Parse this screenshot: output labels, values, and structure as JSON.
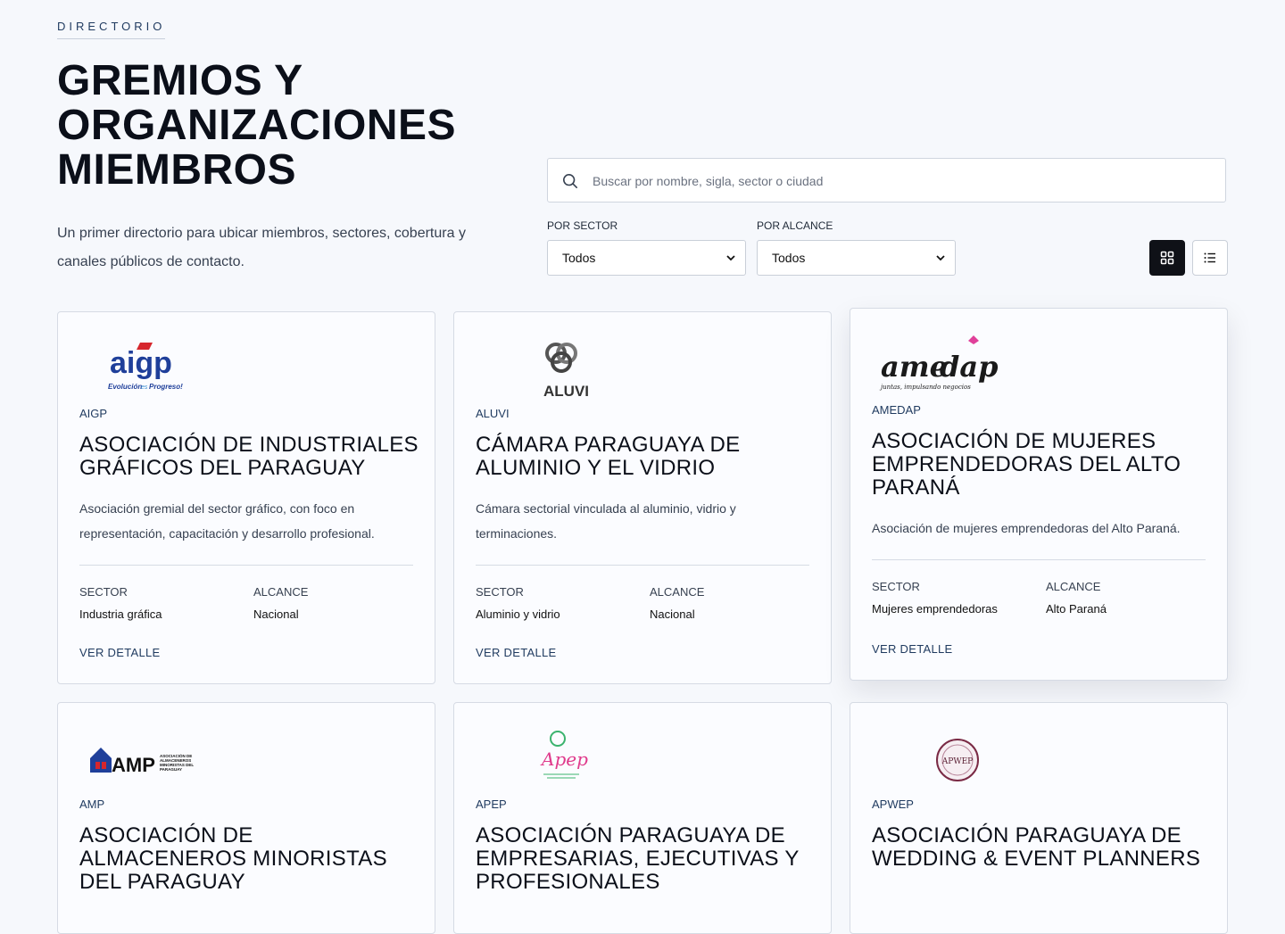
{
  "header": {
    "eyebrow": "DIRECTORIO",
    "title": "GREMIOS Y ORGANIZACIONES MIEMBROS",
    "lede": "Un primer directorio para ubicar miembros, sectores, cobertura y canales públicos de contacto."
  },
  "search": {
    "placeholder": "Buscar por nombre, sigla, sector o ciudad",
    "value": "",
    "icon": "search-icon"
  },
  "filters": {
    "sector_label": "POR SECTOR",
    "sector_value": "Todos",
    "alcance_label": "POR ALCANCE",
    "alcance_value": "Todos"
  },
  "view_toggle": {
    "active": "grid",
    "icons": [
      "grid-icon",
      "list-icon"
    ]
  },
  "labels": {
    "sector": "SECTOR",
    "alcance": "ALCANCE",
    "detail": "VER DETALLE"
  },
  "cards": [
    {
      "abbr": "AIGP",
      "name": "Asociación de Industriales Gráficos del Paraguay",
      "description": "Asociación gremial del sector gráfico, con foco en representación, capacitación y desarrollo profesional.",
      "sector": "Industria gráfica",
      "alcance": "Nacional",
      "logo_text": "aigp",
      "logo_tagline_a": "Evolución",
      "logo_tagline_b": "es",
      "logo_tagline_c": "Progreso!"
    },
    {
      "abbr": "ALUVI",
      "name": "Cámara Paraguaya de Aluminio y el Vidrio",
      "description": "Cámara sectorial vinculada al aluminio, vidrio y terminaciones.",
      "sector": "Aluminio y vidrio",
      "alcance": "Nacional",
      "logo_text": "ALUVI"
    },
    {
      "abbr": "AMEDAP",
      "name": "Asociación de Mujeres Emprendedoras del Alto Paraná",
      "description": "Asociación de mujeres emprendedoras del Alto Paraná.",
      "sector": "Mujeres emprendedoras",
      "alcance": "Alto Paraná",
      "logo_text_a": "ame",
      "logo_text_b": "dap",
      "logo_tagline": "juntas, impulsando negocios"
    },
    {
      "abbr": "AMP",
      "name": "Asociación de Almaceneros Minoristas del Paraguay",
      "logo_text": "AMP",
      "logo_sub": "ASOCIACIÓN DE ALMACENEROS MINORISTAS DEL PARAGUAY"
    },
    {
      "abbr": "APEP",
      "name": "Asociación Paraguaya de Empresarias, Ejecutivas y Profesionales",
      "logo_text": "Apep"
    },
    {
      "abbr": "APWEP",
      "name": "Asociación Paraguaya de Wedding & Event Planners",
      "logo_text": "APWEP"
    }
  ]
}
